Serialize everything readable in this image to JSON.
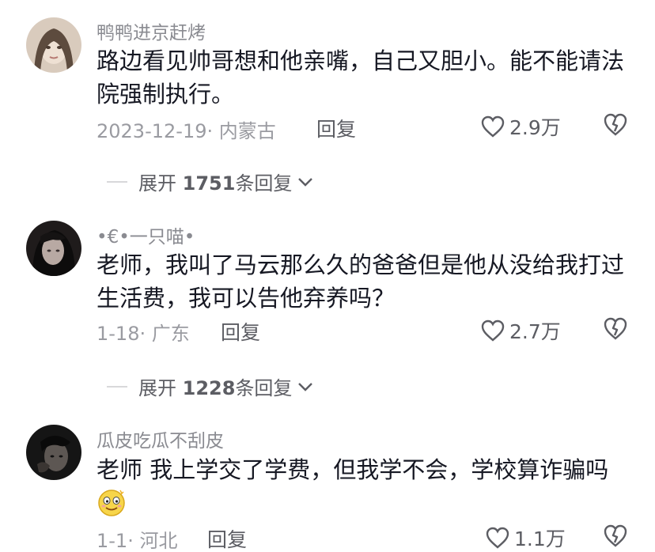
{
  "comments": [
    {
      "username": "鸭鸭进京赶烤",
      "content": "路边看见帅哥想和他亲嘴，自己又胆小。能不能请法院强制执行。",
      "meta": "2023-12-19· 内蒙古",
      "reply_label": "回复",
      "likes": "2.9万",
      "expand": {
        "prefix": "展开",
        "count": "1751",
        "suffix": "条回复"
      },
      "avatar_colors": [
        "#c8b8a6",
        "#6a5a4c",
        "#e7d9cc"
      ]
    },
    {
      "username": "•€•一只喵•",
      "content": "老师，我叫了马云那么久的爸爸但是他从没给我打过生活费，我可以告他弃养吗？",
      "meta": "1-18· 广东",
      "reply_label": "回复",
      "likes": "2.7万",
      "expand": {
        "prefix": "展开",
        "count": "1228",
        "suffix": "条回复"
      },
      "avatar_colors": [
        "#3b3535",
        "#141212",
        "#8a7b76"
      ]
    },
    {
      "username": "瓜皮吃瓜不刮皮",
      "content": "老师 我上学交了学费，但我学不会，学校算诈骗吗",
      "emoji": "smiling-face-emoji",
      "meta": "1-1· 河北",
      "reply_label": "回复",
      "likes": "1.1万",
      "avatar_colors": [
        "#2a2a2a",
        "#0e0e0e",
        "#6f6a66"
      ]
    }
  ],
  "colors": {
    "text_primary": "#161823",
    "text_secondary": "#8a8b91",
    "action": "#5c5d63"
  }
}
